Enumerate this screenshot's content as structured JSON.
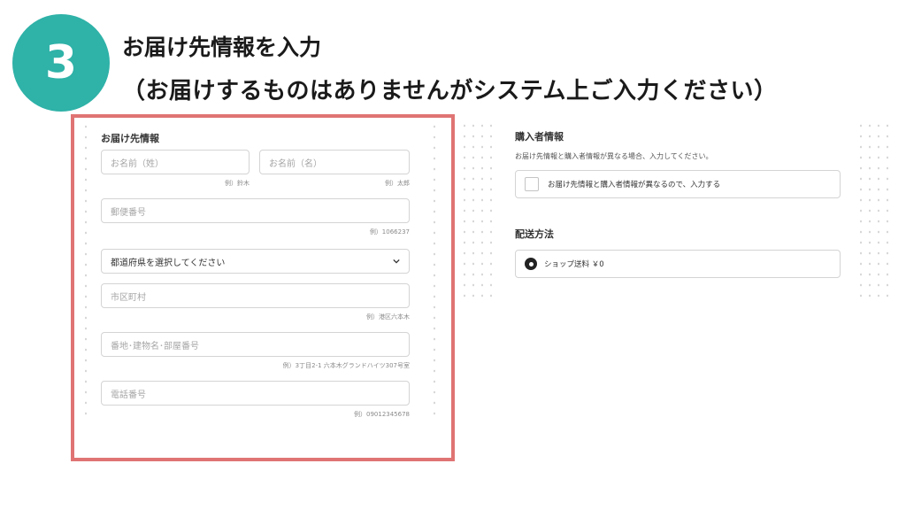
{
  "step": {
    "number": "3",
    "title": "お届け先情報を入力",
    "subtitle": "（お届けするものはありませんがシステム上ご入力ください）"
  },
  "delivery_form": {
    "title": "お届け先情報",
    "last_name": {
      "placeholder": "お名前（姓）",
      "hint": "例）鈴木"
    },
    "first_name": {
      "placeholder": "お名前（名）",
      "hint": "例）太郎"
    },
    "postal_code": {
      "placeholder": "郵便番号",
      "hint": "例）1066237"
    },
    "prefecture": {
      "value": "都道府県を選択してください"
    },
    "city": {
      "placeholder": "市区町村",
      "hint": "例）港区六本木"
    },
    "address": {
      "placeholder": "番地･建物名･部屋番号",
      "hint": "例）3丁目2-1 六本木グランドハイツ307号室"
    },
    "phone": {
      "placeholder": "電話番号",
      "hint": "例）09012345678"
    }
  },
  "purchaser": {
    "title": "購入者情報",
    "description": "お届け先情報と購入者情報が異なる場合、入力してください。",
    "checkbox_label": "お届け先情報と購入者情報が異なるので、入力する"
  },
  "shipping": {
    "title": "配送方法",
    "option_label": "ショップ送料 ￥0"
  },
  "colors": {
    "accent": "#2fb2a8",
    "highlight_border": "#e07474"
  }
}
